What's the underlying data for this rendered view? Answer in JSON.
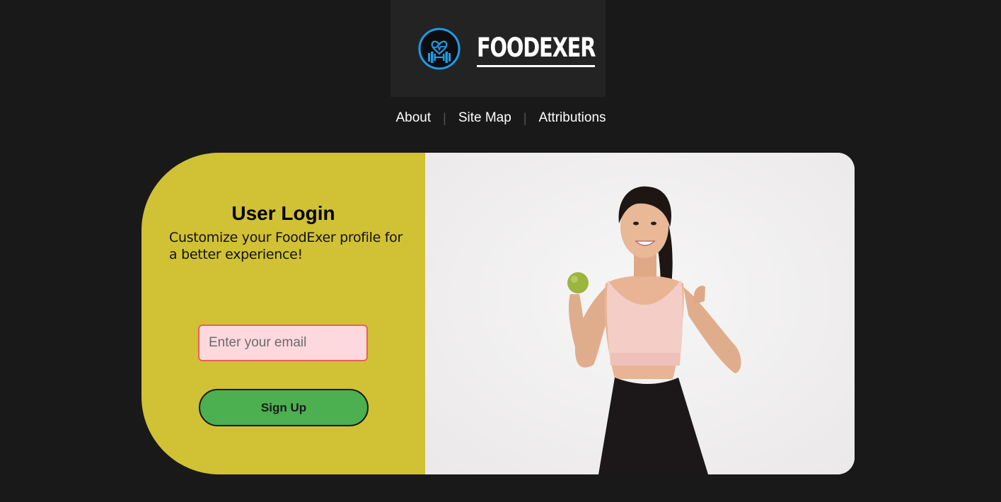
{
  "header": {
    "brand": "FOODEXER",
    "logo_icon": "heart-dumbbell-icon"
  },
  "nav": {
    "items": [
      "About",
      "Site Map",
      "Attributions"
    ],
    "separator": "|"
  },
  "login": {
    "title": "User Login",
    "subtitle": "Customize your FoodExer profile for a better experience!",
    "email_placeholder": "Enter your email",
    "email_value": "",
    "signup_label": "Sign Up"
  },
  "colors": {
    "page_bg": "#191919",
    "header_bg": "#232323",
    "accent_blue": "#1e9be8",
    "panel_yellow": "#d1c134",
    "input_bg": "#fdd9dd",
    "input_border": "#e95f5f",
    "button_green": "#4caf50"
  },
  "image": {
    "description_icon": "fitness-woman-photo"
  }
}
